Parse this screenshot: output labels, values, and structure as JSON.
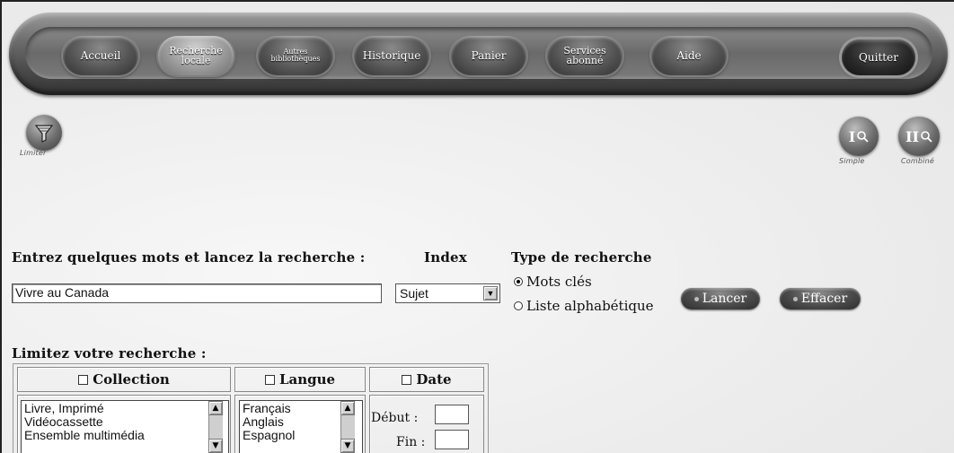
{
  "nav": {
    "items": [
      {
        "label": "Accueil"
      },
      {
        "label": "Recherche locale"
      },
      {
        "label": "Autres bibliothèques"
      },
      {
        "label": "Historique"
      },
      {
        "label": "Panier"
      },
      {
        "label": "Services abonné"
      },
      {
        "label": "Aide"
      }
    ],
    "quit": "Quitter"
  },
  "tools": {
    "limit_caption": "Limiter",
    "simple_caption": "Simple",
    "combined_caption": "Combiné",
    "simple_glyph": "I",
    "combined_glyph": "II"
  },
  "search": {
    "prompt": "Entrez quelques mots et lancez la recherche :",
    "query_value": "Vivre au Canada",
    "index_label": "Index",
    "index_value": "Sujet",
    "type_label": "Type de recherche",
    "type_options": [
      "Mots clés",
      "Liste alphabétique"
    ],
    "type_selected": 0,
    "launch_label": "Lancer",
    "clear_label": "Effacer"
  },
  "limits": {
    "title": "Limitez votre recherche :",
    "collection_label": "Collection",
    "collection_items": [
      "Livre, Imprimé",
      "Vidéocassette",
      "Ensemble multimédia"
    ],
    "language_label": "Langue",
    "language_items": [
      "Français",
      "Anglais",
      "Espagnol"
    ],
    "date_label": "Date",
    "start_label": "Début :",
    "end_label": "Fin :"
  }
}
